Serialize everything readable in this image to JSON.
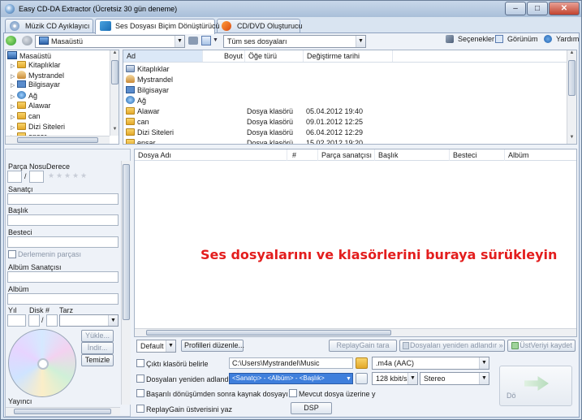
{
  "window": {
    "title": "Easy CD-DA Extractor (Ücretsiz 30 gün deneme)",
    "controls": {
      "minimize": "–",
      "maximize": "□",
      "close": "✕"
    }
  },
  "tabs": [
    {
      "label": "Müzik CD Ayıklayıcı",
      "icon": "cd-icon"
    },
    {
      "label": "Ses Dosyası Biçim Dönüştürücü",
      "icon": "audio-convert-icon"
    },
    {
      "label": "CD/DVD Oluşturucu",
      "icon": "burn-icon"
    }
  ],
  "toolbar": {
    "location": "Masaüstü",
    "filter": "Tüm ses dosyaları",
    "options": "Seçenekler",
    "view": "Görünüm",
    "help": "Yardım"
  },
  "tree": {
    "items": [
      {
        "label": "Masaüstü",
        "icon": "desktop-icon"
      },
      {
        "label": "Kitaplıklar",
        "icon": "folder-icon"
      },
      {
        "label": "Mystrandel",
        "icon": "user-icon"
      },
      {
        "label": "Bilgisayar",
        "icon": "computer-icon"
      },
      {
        "label": "Ağ",
        "icon": "network-icon"
      },
      {
        "label": "Alawar",
        "icon": "folder-icon"
      },
      {
        "label": "can",
        "icon": "folder-icon"
      },
      {
        "label": "Dizi Siteleri",
        "icon": "folder-icon"
      },
      {
        "label": "ensar",
        "icon": "folder-icon"
      }
    ]
  },
  "files": {
    "columns": [
      "Ad",
      "Boyut",
      "Öğe türü",
      "Değiştirme tarihi"
    ],
    "rows": [
      {
        "name": "Kitaplıklar",
        "size": "",
        "type": "",
        "date": ""
      },
      {
        "name": "Mystrandel",
        "size": "",
        "type": "",
        "date": ""
      },
      {
        "name": "Bilgisayar",
        "size": "",
        "type": "",
        "date": ""
      },
      {
        "name": "Ağ",
        "size": "",
        "type": "",
        "date": ""
      },
      {
        "name": "Alawar",
        "size": "",
        "type": "Dosya klasörü",
        "date": "05.04.2012 19:40"
      },
      {
        "name": "can",
        "size": "",
        "type": "Dosya klasörü",
        "date": "09.01.2012 12:25"
      },
      {
        "name": "Dizi Siteleri",
        "size": "",
        "type": "Dosya klasörü",
        "date": "06.04.2012 12:29"
      },
      {
        "name": "ensar",
        "size": "",
        "type": "Dosya klasörü",
        "date": "15.02.2012 19:20"
      }
    ]
  },
  "metadata": {
    "track_no": "Parça Nosu",
    "rating": "Derece",
    "slash": "/",
    "artist": "Sanatçı",
    "title": "Başlık",
    "composer": "Besteci",
    "compilation": "Derlemenin parçası",
    "album_artist": "Albüm Sanatçısı",
    "album": "Albüm",
    "year": "Yıl",
    "disc_no": "Disk #",
    "genre": "Tarz",
    "load": "Yükle...",
    "download": "İndir...",
    "clear": "Temizle",
    "publisher": "Yayıncı"
  },
  "tracks": {
    "columns": [
      "Dosya Adı",
      "#",
      "Parça sanatçısı",
      "Başlık",
      "Besteci",
      "Albüm"
    ],
    "drop_hint": "Ses dosyalarını ve klasörlerini buraya sürükleyin"
  },
  "bottom": {
    "profile": "Default",
    "edit_profiles": "Profilleri düzenle...",
    "replaygain": "ReplayGain tara",
    "rename_files": "Dosyaları yeniden adlandır »",
    "save_metadata": "ÜstVeriyi kaydet",
    "output_folder_label": "Çıktı klasörü belirle",
    "output_folder": "C:\\Users\\Mystrandel\\Music",
    "rename_label": "Dosyaları yeniden adlandır",
    "rename_pattern": "<Sanatçı> - <Albüm> - <Başlık>",
    "delete_source": "Başarılı dönüşümden sonra kaynak dosyayı sil",
    "overwrite": "Mevcut dosya üzerine y",
    "replaygain_write": "ReplayGain üstverisini yaz",
    "dsp": "DSP",
    "format": ".m4a (AAC)",
    "bitrate": "128 kbit/s",
    "channels": "Stereo",
    "convert": "Dö"
  }
}
